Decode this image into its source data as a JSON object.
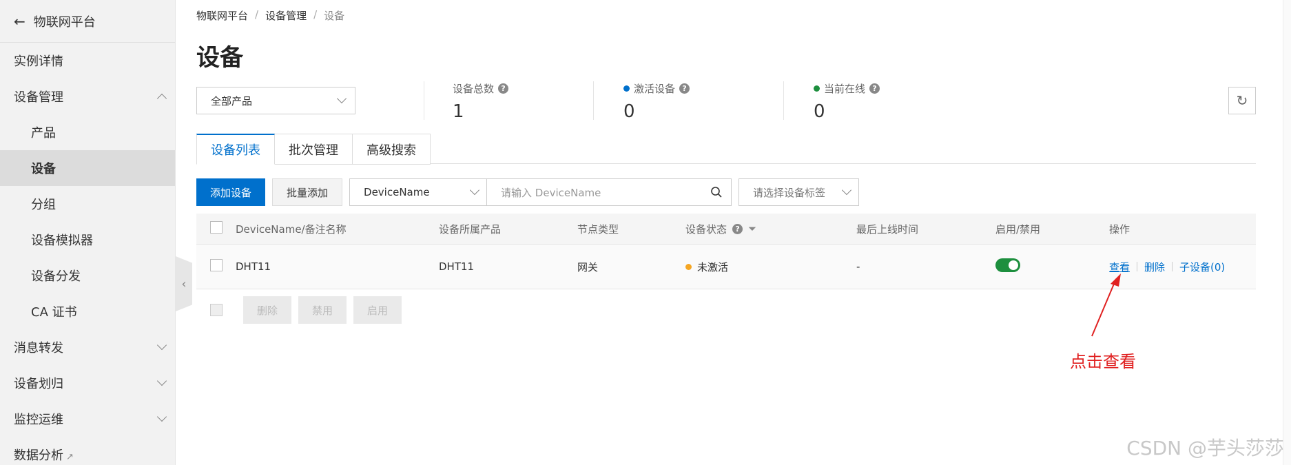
{
  "sidebar": {
    "title": "物联网平台",
    "items": [
      {
        "label": "实例详情"
      },
      {
        "label": "设备管理"
      },
      {
        "label": "产品"
      },
      {
        "label": "设备"
      },
      {
        "label": "分组"
      },
      {
        "label": "设备模拟器"
      },
      {
        "label": "设备分发"
      },
      {
        "label": "CA 证书"
      },
      {
        "label": "消息转发"
      },
      {
        "label": "设备划归"
      },
      {
        "label": "监控运维"
      },
      {
        "label": "数据分析"
      }
    ]
  },
  "breadcrumb": [
    "物联网平台",
    "设备管理",
    "设备"
  ],
  "page_title": "设备",
  "product_filter": {
    "value": "全部产品"
  },
  "stats": [
    {
      "label": "设备总数",
      "value": "1"
    },
    {
      "label": "激活设备",
      "value": "0",
      "color": "#0070cc"
    },
    {
      "label": "当前在线",
      "value": "0",
      "color": "#1d8f3e"
    }
  ],
  "tabs": [
    {
      "label": "设备列表"
    },
    {
      "label": "批次管理"
    },
    {
      "label": "高级搜索"
    }
  ],
  "toolbar": {
    "add_label": "添加设备",
    "batch_add_label": "批量添加",
    "field_value": "DeviceName",
    "search_placeholder": "请输入 DeviceName",
    "tag_placeholder": "请选择设备标签"
  },
  "table": {
    "headers": [
      "DeviceName/备注名称",
      "设备所属产品",
      "节点类型",
      "设备状态",
      "最后上线时间",
      "启用/禁用",
      "操作"
    ],
    "rows": [
      {
        "name": "DHT11",
        "product": "DHT11",
        "node_type": "网关",
        "status": "未激活",
        "last_online": "-",
        "enabled": true,
        "actions": [
          "查看",
          "删除",
          "子设备(0)"
        ]
      }
    ]
  },
  "footer_actions": [
    "删除",
    "禁用",
    "启用"
  ],
  "annotation": "点击查看",
  "watermark": "CSDN @芋头莎莎"
}
